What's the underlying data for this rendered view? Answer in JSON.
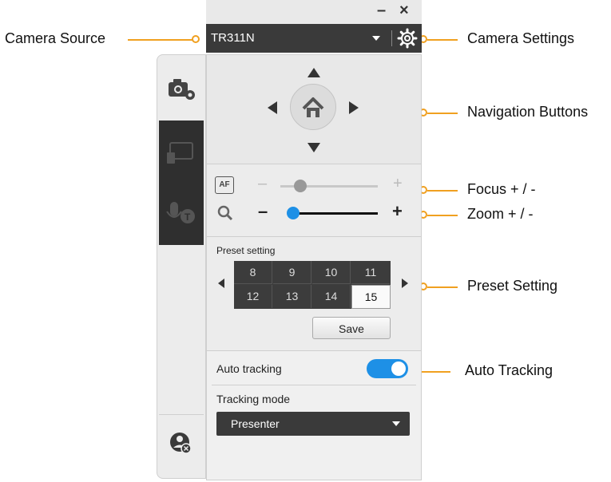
{
  "annotations": {
    "camera_source": "Camera Source",
    "camera_settings": "Camera Settings",
    "navigation_buttons": "Navigation Buttons",
    "focus": "Focus + / -",
    "zoom": "Zoom + / -",
    "preset_setting": "Preset Setting",
    "auto_tracking": "Auto Tracking"
  },
  "window": {
    "minimize": "–",
    "close": "×"
  },
  "camera_source": {
    "value": "TR311N"
  },
  "focus": {
    "af_label": "AF",
    "minus": "–",
    "plus": "+",
    "level": 0.2
  },
  "zoom": {
    "minus": "–",
    "plus": "+",
    "level": 0.0
  },
  "preset": {
    "title": "Preset setting",
    "slots": [
      "8",
      "9",
      "10",
      "11",
      "12",
      "13",
      "14",
      "15"
    ],
    "selected": "15",
    "save_label": "Save"
  },
  "tracking": {
    "auto_label": "Auto tracking",
    "auto_enabled": true,
    "mode_label": "Tracking mode",
    "mode_value": "Presenter"
  },
  "colors": {
    "accent": "#1e90e6",
    "callout": "#f0a020",
    "dark": "#3a3a3a"
  },
  "icons": [
    "camera-settings-icon",
    "screen-share-icon",
    "mic-tracking-icon",
    "user-remove-icon",
    "gear-icon",
    "home-icon",
    "magnifier-icon"
  ]
}
